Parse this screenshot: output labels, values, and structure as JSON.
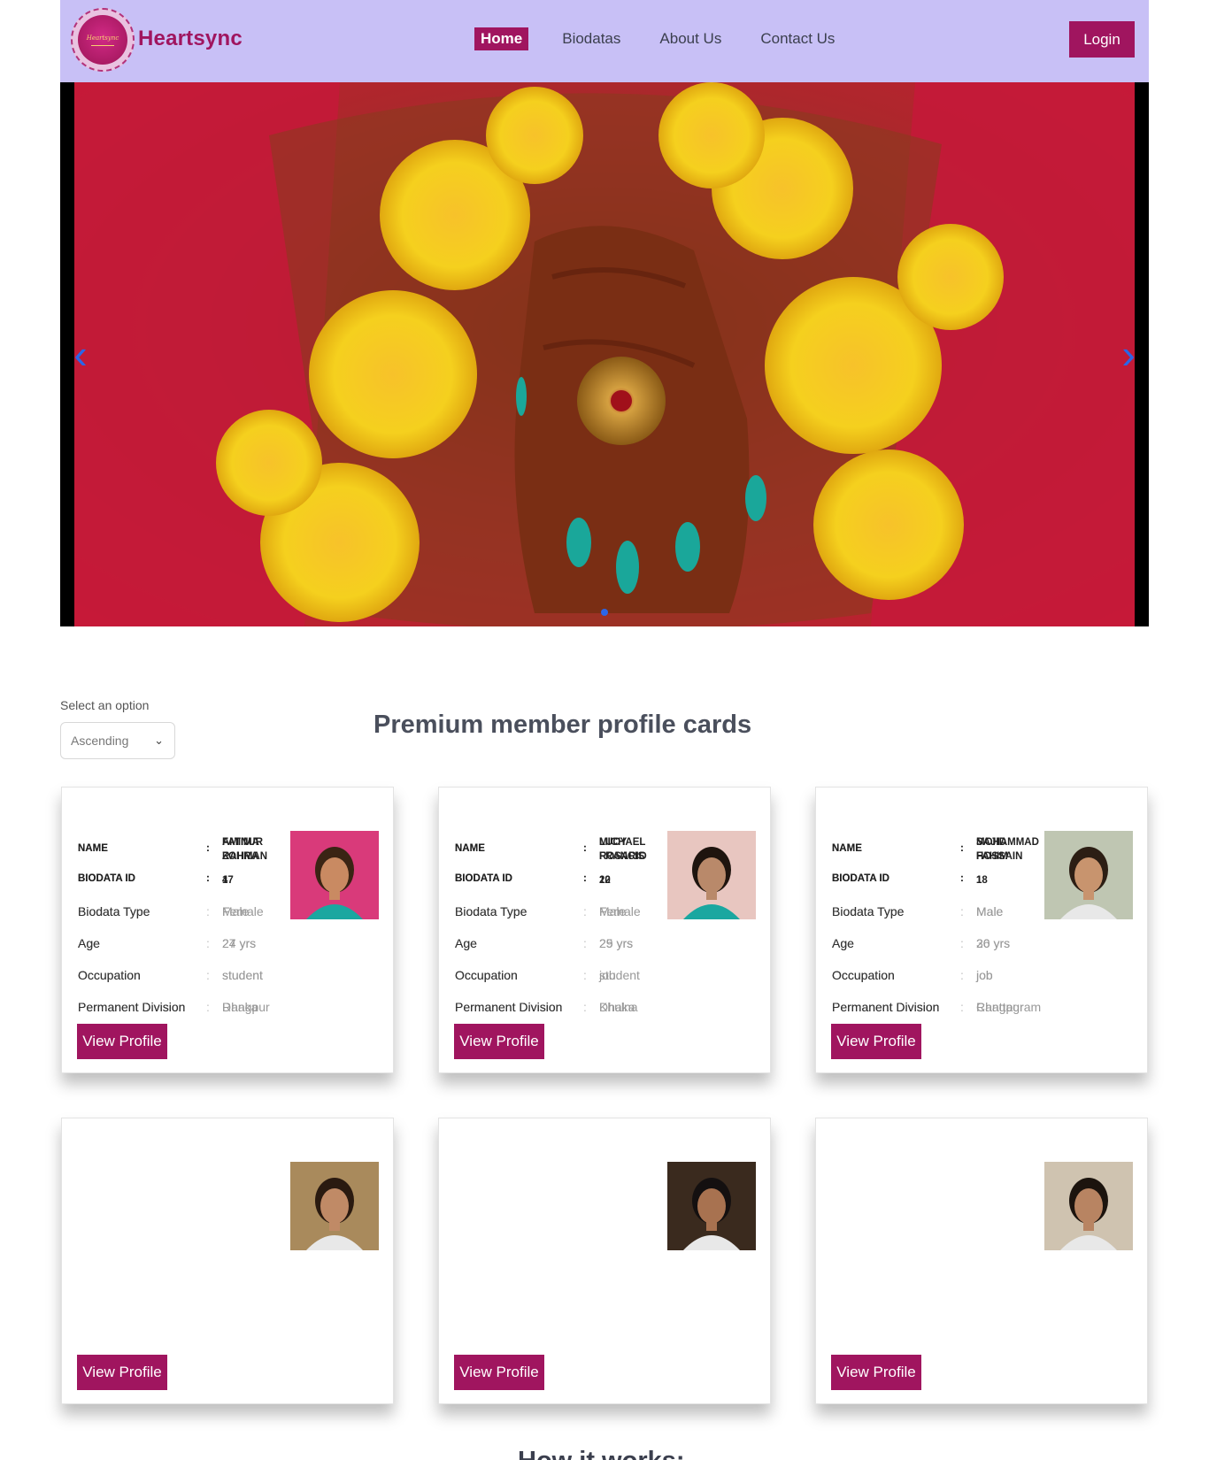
{
  "nav": {
    "brand": "Heartsync",
    "logo_text": "Heartsync",
    "links": [
      "Home",
      "Biodatas",
      "About Us",
      "Contact Us"
    ],
    "login": "Login"
  },
  "colors": {
    "nav_bg": "#c8c0f6",
    "accent": "#a0155f",
    "arrow": "#2a66e8"
  },
  "hero": {
    "prev_icon": "chevron-left-icon",
    "next_icon": "chevron-right-icon",
    "active_slide": 1
  },
  "sort": {
    "label": "Select an option",
    "value": "Ascending"
  },
  "section_title": "Premium member profile cards",
  "labels": {
    "name": "NAME",
    "biodata_id": "BIODATA ID",
    "biodata_type": "Biodata Type",
    "age": "Age",
    "occupation": "Occupation",
    "division": "Permanent Division",
    "sep": ":",
    "view": "View Profile"
  },
  "cards": [
    {
      "name": "FATIMA ZOHRA",
      "id": "4",
      "type": "Female",
      "age": "24 yrs",
      "occupation": "student",
      "division": "Dhaka"
    },
    {
      "name": "LUCY FRANCIS",
      "id": "20",
      "type": "Female",
      "age": "25 yrs",
      "occupation": "student",
      "division": "Dhaka"
    },
    {
      "name": "SAJID HOSSAIN",
      "id": "18",
      "type": "Male",
      "age": "26 yrs",
      "occupation": "job",
      "division": "Chattagram"
    },
    {
      "name": "AMINUR RAHMAN",
      "id": "17",
      "type": "Male",
      "age": "27 yrs",
      "occupation": "student",
      "division": "Rangpur"
    },
    {
      "name": "MICHAEL ROSARIO",
      "id": "12",
      "type": "Male",
      "age": "29 yrs",
      "occupation": "job",
      "division": "Khulna"
    },
    {
      "name": "MOHAMMAD FAHIM",
      "id": "1",
      "type": "Male",
      "age": "30 yrs",
      "occupation": "job",
      "division": "Rangpur"
    }
  ],
  "how_title": "How it works:"
}
